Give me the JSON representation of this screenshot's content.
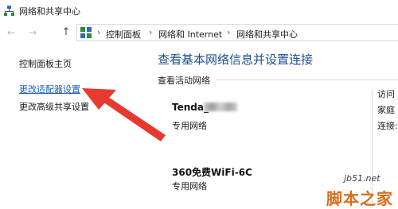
{
  "window": {
    "title": "网络和共享中心"
  },
  "navigation": {
    "breadcrumbs": [
      "控制面板",
      "网络和 Internet",
      "网络和共享中心"
    ]
  },
  "sidebar": {
    "items": [
      {
        "label": "控制面板主页"
      },
      {
        "label": "更改适配器设置"
      },
      {
        "label": "更改高级共享设置"
      }
    ]
  },
  "main": {
    "title": "查看基本网络信息并设置连接",
    "section_label": "查看活动网络",
    "networks": [
      {
        "name": "Tenda_",
        "type": "专用网络"
      },
      {
        "name": "360免费WiFi-6C",
        "type": "专用网络"
      }
    ],
    "right_labels": [
      "访问",
      "家庭",
      "连接:"
    ]
  },
  "watermark": {
    "url": "jb51.net",
    "site": "脚本之家"
  },
  "colors": {
    "link": "#1a5fb4",
    "title": "#1e4e8c",
    "arrow": "#e8392f",
    "watermark": "#d96d1c"
  }
}
